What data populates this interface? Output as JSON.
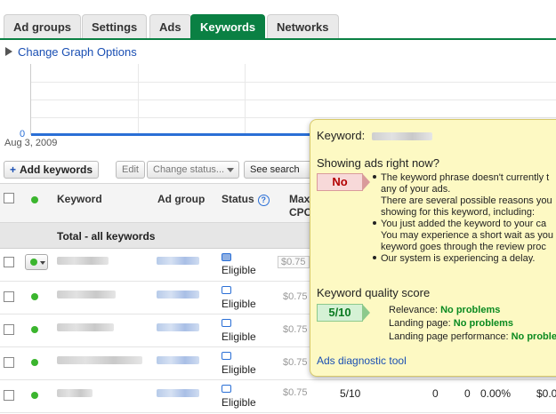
{
  "tabs": [
    {
      "label": "Ad groups"
    },
    {
      "label": "Settings"
    },
    {
      "label": "Ads"
    },
    {
      "label": "Keywords",
      "active": true
    },
    {
      "label": "Networks"
    }
  ],
  "graph": {
    "options_label": "Change Graph Options",
    "y_tick": "0",
    "x_start": "Aug 3, 2009"
  },
  "toolbar": {
    "add_keywords": "Add keywords",
    "edit": "Edit",
    "change_status": "Change status...",
    "see_search": "See search te"
  },
  "table": {
    "headers": {
      "keyword": "Keyword",
      "ad_group": "Ad group",
      "status": "Status",
      "max_cpc_1": "Max",
      "max_cpc_2": "CPC"
    },
    "total_label": "Total - all keywords",
    "rows": [
      {
        "status": "Eligible",
        "bid": "$0.75"
      },
      {
        "status": "Eligible",
        "bid": "$0.75"
      },
      {
        "status": "Eligible",
        "bid": "$0.75"
      },
      {
        "status": "Eligible",
        "bid": "$0.75"
      },
      {
        "status": "Eligible",
        "bid": "$0.75",
        "quality": "5/10",
        "clicks": "0",
        "impr": "0",
        "ctr": "0.00%",
        "cost": "$0.0"
      }
    ]
  },
  "popup": {
    "keyword_label": "Keyword:",
    "showing_title": "Showing ads right now?",
    "showing_value": "No",
    "reasons": [
      "The keyword phrase doesn't currently t",
      "any of your ads.",
      "There are several possible reasons you",
      "showing for this keyword, including:",
      "You just added the keyword to your ca",
      "You may experience a short wait as you",
      "keyword goes through the review proc",
      "Our system is experiencing a delay."
    ],
    "quality_title": "Keyword quality score",
    "quality_value": "5/10",
    "quality_items": [
      {
        "label": "Relevance:",
        "value": "No problems"
      },
      {
        "label": "Landing page:",
        "value": "No problems"
      },
      {
        "label": "Landing page performance:",
        "value": "No proble"
      }
    ],
    "diagnostic_link": "Ads diagnostic tool"
  },
  "colors": {
    "tab_active": "#0a8043",
    "link": "#1a4fb3",
    "popup_bg": "#fdf9c3",
    "status_dot": "#3bb52e"
  }
}
